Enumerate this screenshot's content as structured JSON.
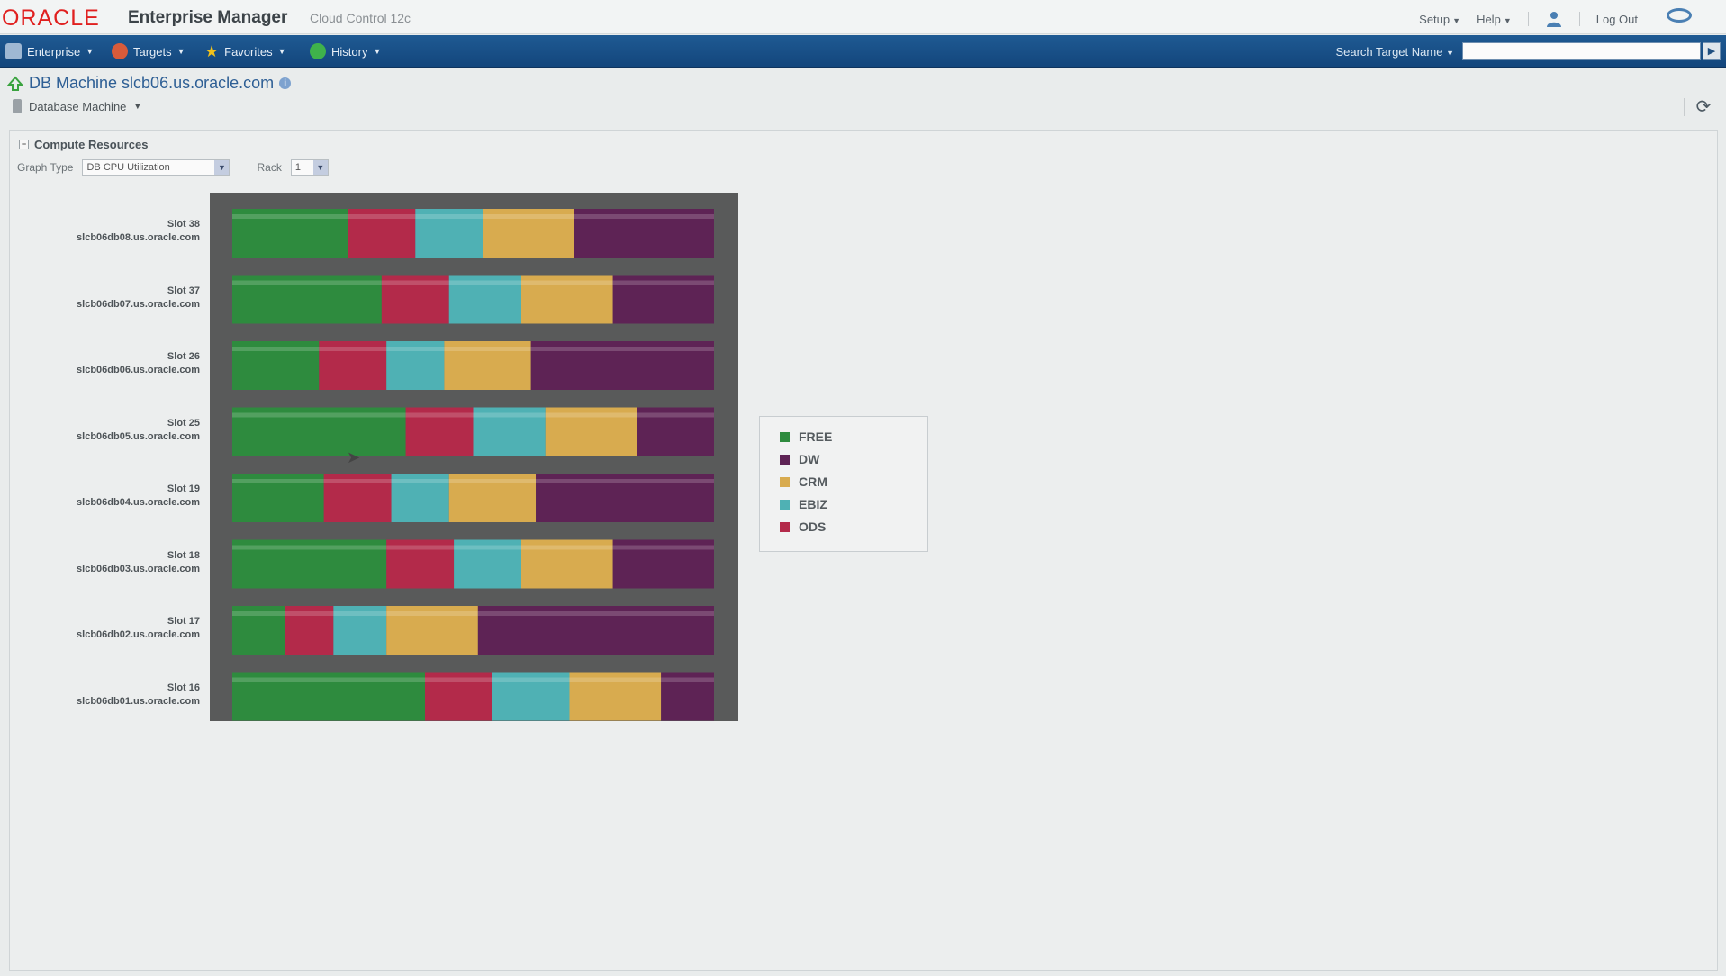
{
  "brand": {
    "logo": "ORACLE",
    "product": "Enterprise Manager",
    "edition": "Cloud Control 12c"
  },
  "top_links": {
    "setup": "Setup",
    "help": "Help",
    "logout": "Log Out"
  },
  "nav": {
    "items": [
      {
        "label": "Enterprise",
        "icon": "enterprise-icon"
      },
      {
        "label": "Targets",
        "icon": "targets-icon"
      },
      {
        "label": "Favorites",
        "icon": "star-icon"
      },
      {
        "label": "History",
        "icon": "history-icon"
      }
    ],
    "search_label": "Search Target Name",
    "search_value": ""
  },
  "page": {
    "title": "DB Machine slcb06.us.oracle.com",
    "target_menu": "Database Machine"
  },
  "region": {
    "title": "Compute Resources",
    "graph_type_label": "Graph Type",
    "graph_type_value": "DB CPU Utilization",
    "rack_label": "Rack",
    "rack_value": "1"
  },
  "chart_data": {
    "type": "bar",
    "orientation": "horizontal",
    "stacked": true,
    "normalized": true,
    "categories": [
      {
        "slot": "Slot 38",
        "host": "slcb06db08.us.oracle.com"
      },
      {
        "slot": "Slot 37",
        "host": "slcb06db07.us.oracle.com"
      },
      {
        "slot": "Slot 26",
        "host": "slcb06db06.us.oracle.com"
      },
      {
        "slot": "Slot 25",
        "host": "slcb06db05.us.oracle.com"
      },
      {
        "slot": "Slot 19",
        "host": "slcb06db04.us.oracle.com"
      },
      {
        "slot": "Slot 18",
        "host": "slcb06db03.us.oracle.com"
      },
      {
        "slot": "Slot 17",
        "host": "slcb06db02.us.oracle.com"
      },
      {
        "slot": "Slot 16",
        "host": "slcb06db01.us.oracle.com"
      }
    ],
    "series": [
      {
        "name": "FREE",
        "color": "#2e8b3e",
        "values": [
          24,
          31,
          18,
          36,
          19,
          32,
          11,
          40
        ]
      },
      {
        "name": "ODS",
        "color": "#b32a4a",
        "values": [
          14,
          14,
          14,
          14,
          14,
          14,
          10,
          14
        ]
      },
      {
        "name": "EBIZ",
        "color": "#4fb1b4",
        "values": [
          14,
          15,
          12,
          15,
          12,
          14,
          11,
          16
        ]
      },
      {
        "name": "CRM",
        "color": "#d8ab4f",
        "values": [
          19,
          19,
          18,
          19,
          18,
          19,
          19,
          19
        ]
      },
      {
        "name": "DW",
        "color": "#5e2355",
        "values": [
          29,
          21,
          38,
          16,
          37,
          21,
          49,
          11
        ]
      }
    ],
    "legend_order": [
      "FREE",
      "DW",
      "CRM",
      "EBIZ",
      "ODS"
    ],
    "legend_position": "right"
  }
}
